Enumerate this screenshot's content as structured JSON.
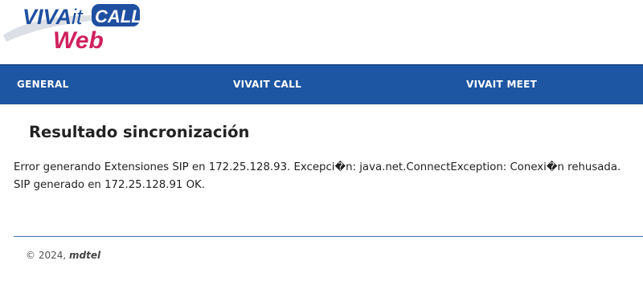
{
  "logo": {
    "brand_part1": "VIVA",
    "brand_part2": "it",
    "brand_part3": "CALL",
    "subtitle": "Web",
    "colors": {
      "blue": "#1f4fa0",
      "magenta": "#d0215f"
    }
  },
  "nav": {
    "items": [
      {
        "label": "GENERAL"
      },
      {
        "label": "VIVAIT CALL"
      },
      {
        "label": "VIVAIT MEET"
      }
    ],
    "background": "#1d56a3"
  },
  "main": {
    "title": "Resultado sincronización",
    "messages": [
      "Error generando Extensiones SIP en 172.25.128.93. Excepci�n: java.net.ConnectException: Conexi�n rehusada.",
      "SIP generado en 172.25.128.91 OK."
    ]
  },
  "footer": {
    "copyright": "© 2024, ",
    "company": "mdtel"
  }
}
